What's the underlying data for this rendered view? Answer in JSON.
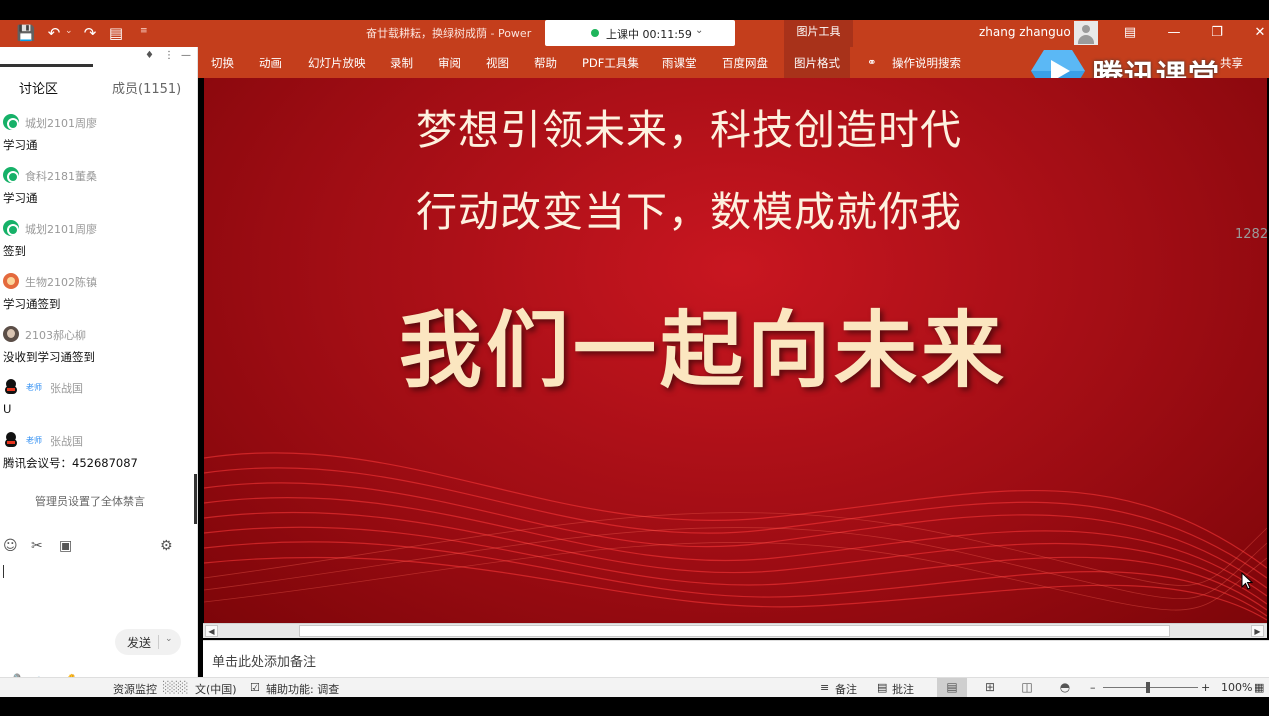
{
  "window": {
    "doc_title": "奋廿载耕耘，换绿树成荫 - Power",
    "live_status": "上课中 00:11:59",
    "tool_group": "图片工具",
    "username": "zhang zhanguo"
  },
  "ribbon": {
    "tabs": [
      "切换",
      "动画",
      "幻灯片放映",
      "录制",
      "审阅",
      "视图",
      "帮助",
      "PDF工具集",
      "雨课堂",
      "百度网盘",
      "图片格式",
      "操作说明搜索"
    ],
    "share": "共享"
  },
  "brand": {
    "name": "腾讯课堂"
  },
  "panel": {
    "tab_discuss": "讨论区",
    "tab_members": "成员(1151)",
    "messages": [
      {
        "name": "城划2101周廖",
        "text": "学习通",
        "avatar": "green"
      },
      {
        "name": "食科2181董桑",
        "text": "学习通",
        "avatar": "green"
      },
      {
        "name": "城划2101周廖",
        "text": "签到",
        "avatar": "green"
      },
      {
        "name": "生物2102陈镇",
        "text": "学习通签到",
        "avatar": "orange"
      },
      {
        "name": "2103郝心柳",
        "text": "没收到学习通签到",
        "avatar": "dark"
      },
      {
        "name": "张战国",
        "badge": "老师",
        "text": "U",
        "avatar": "qq"
      },
      {
        "name": "张战国",
        "badge": "老师",
        "text": "腾讯会议号：452687087",
        "avatar": "qq"
      }
    ],
    "muted_note": "管理员设置了全体禁言",
    "send_label": "发送"
  },
  "slide": {
    "line1": "梦想引领未来，科技创造时代",
    "line2": "行动改变当下，数模成就你我",
    "main": "我们一起向未来"
  },
  "side_number": "1282",
  "notes_placeholder": "单击此处添加备注",
  "statusbar": {
    "resource_monitor": "资源监控",
    "language_fragment": "文(中国)",
    "accessibility": "辅助功能: 调查",
    "notes": "备注",
    "comments": "批注",
    "zoom": "100%",
    "zoom_level": 0.47
  },
  "colors": {
    "ppt_accent": "#c43e1c",
    "slide_red": "#b0101a",
    "live_dot": "#1fb55b"
  }
}
